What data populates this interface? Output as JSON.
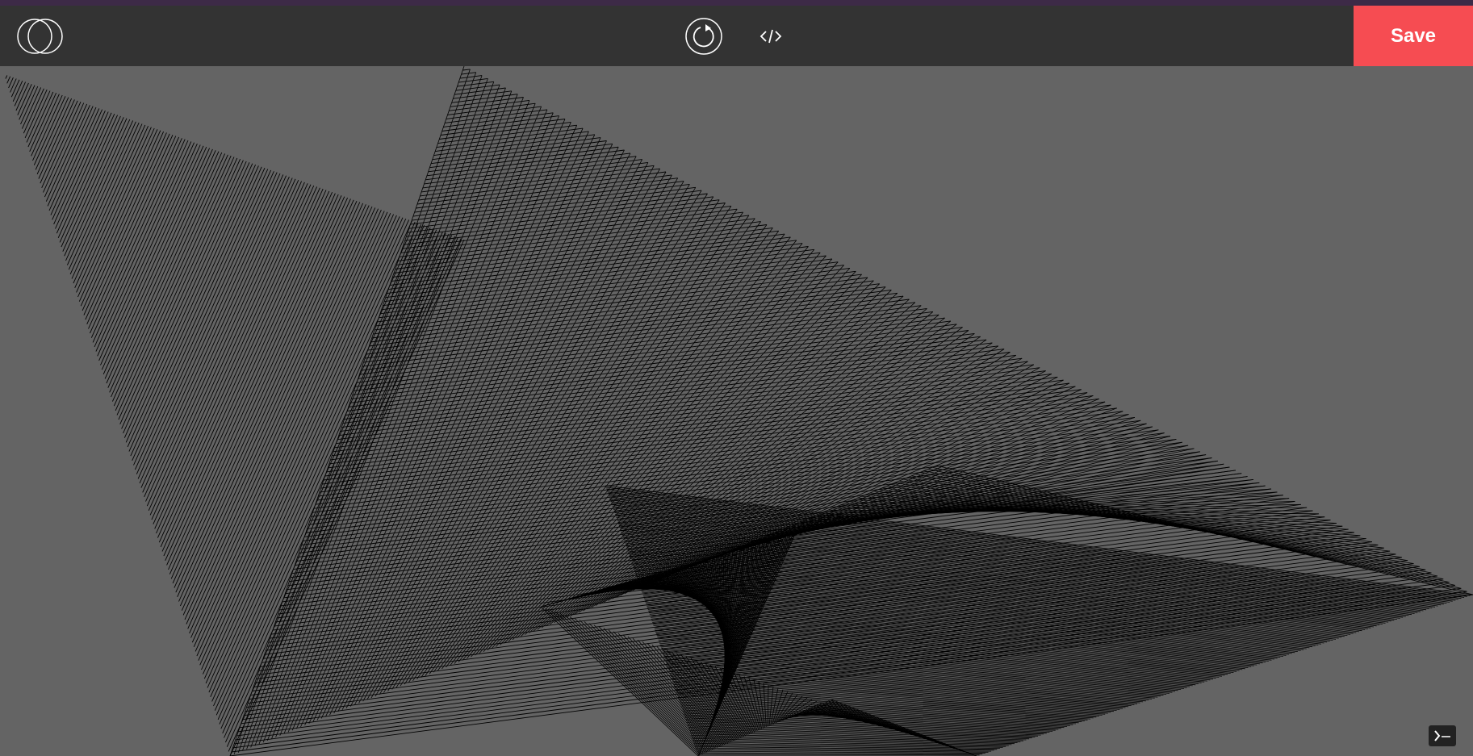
{
  "app": {
    "accent_stripe_color": "#3d2a47",
    "toolbar_color": "#333333",
    "canvas_color": "#646464"
  },
  "toolbar": {
    "logo_icon": "overlapping-circles-logo-icon",
    "reload_icon": "reload-icon",
    "code_icon": "code-brackets-icon",
    "save_label": "Save",
    "save_color": "#f64c52"
  },
  "canvas": {
    "line_color": "#000000"
  },
  "console": {
    "icon": "terminal-prompt-icon"
  }
}
